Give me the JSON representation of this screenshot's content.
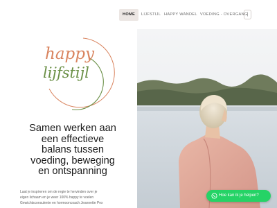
{
  "nav": {
    "items": [
      {
        "label": "HOME",
        "active": true
      },
      {
        "label": "LIJFSTIJL",
        "active": false
      },
      {
        "label": "HAPPY WANDEL",
        "active": false
      },
      {
        "label": "VOEDING - OVERGANG",
        "active": false
      }
    ],
    "more_icon": "more-icon",
    "more_label": "|"
  },
  "logo": {
    "line1": "happy",
    "line2": "lijfstijl",
    "color_line1": "#d9845f",
    "color_line2": "#6a8f46"
  },
  "hero": {
    "headline_lines": [
      "Samen werken aan",
      "een effectieve",
      "balans tussen",
      "voeding, beweging",
      "en ontspanning"
    ],
    "intro_line1": "Laat je inspireren om de regie te hervinden over je",
    "intro_line2": "eigen lichaam en je weer 100% happy te voelen",
    "intro_line3": "Gewichtsconsulente  en hormooncoach Jeannette Pex"
  },
  "chat": {
    "label": "Hoe kan ik je helpen?",
    "icon": "whatsapp-icon",
    "color": "#25d366"
  }
}
